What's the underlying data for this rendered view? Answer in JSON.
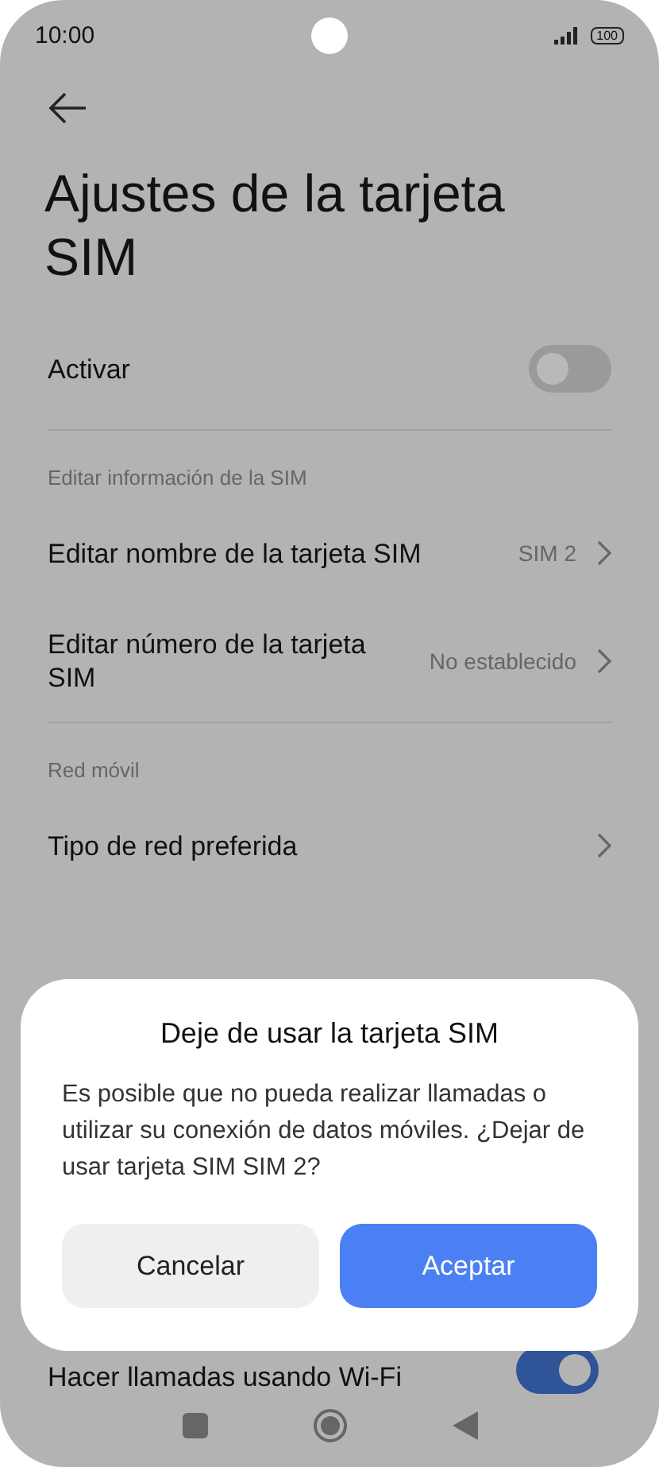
{
  "status_bar": {
    "time": "10:00",
    "battery": "100"
  },
  "title": "Ajustes de la tarjeta SIM",
  "items": [
    {
      "kind": "toggle",
      "label": "Activar",
      "on": false
    },
    {
      "kind": "header",
      "label": "Editar información de la SIM"
    },
    {
      "kind": "link",
      "label": "Editar nombre de la tarjeta SIM",
      "value": "SIM 2"
    },
    {
      "kind": "link",
      "label": "Editar número de la tarjeta SIM",
      "value": "No establecido"
    },
    {
      "kind": "header",
      "label": "Red móvil"
    },
    {
      "kind": "link",
      "label": "Tipo de red preferida"
    }
  ],
  "bottom_item": {
    "label": "Hacer llamadas usando Wi-Fi",
    "on": true
  },
  "dialog": {
    "title": "Deje de usar la tarjeta SIM",
    "message": "Es posible que no pueda realizar llamadas o utilizar su conexión de datos móviles. ¿Dejar de usar tarjeta SIM SIM 2?",
    "buttons": [
      {
        "label": "Cancelar",
        "kind": "secondary"
      },
      {
        "label": "Aceptar",
        "kind": "primary"
      }
    ]
  }
}
